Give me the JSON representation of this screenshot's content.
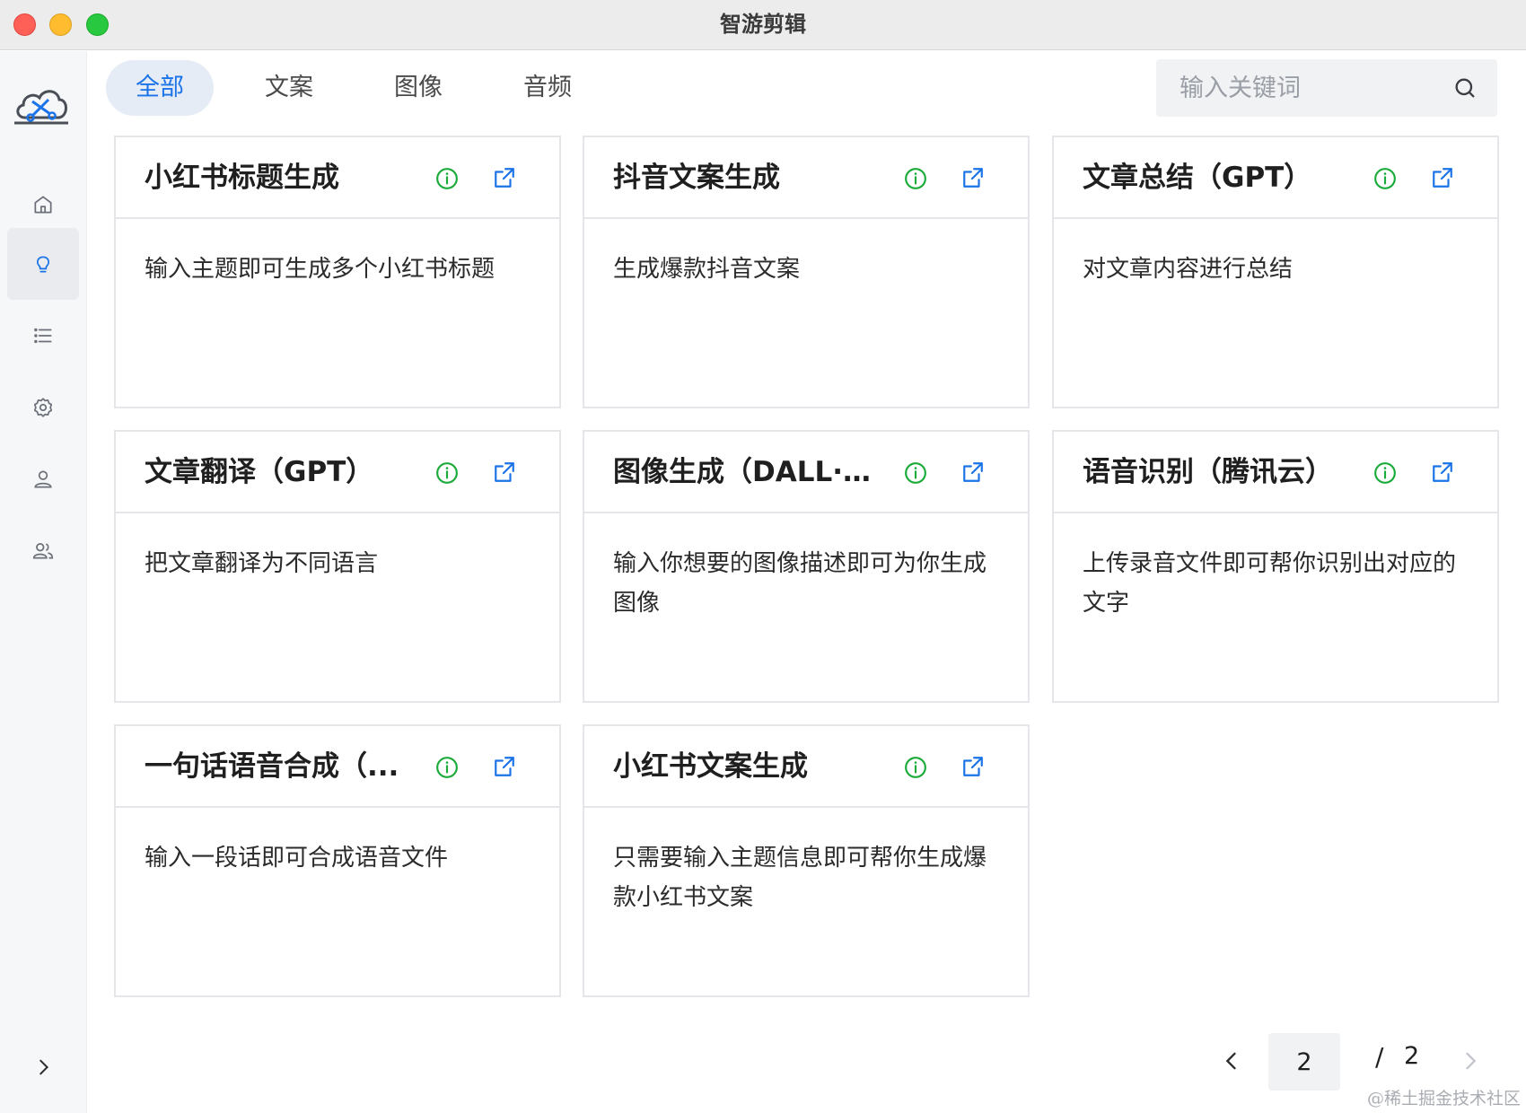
{
  "window": {
    "title": "智游剪辑"
  },
  "sidebar": {
    "logo": "cloud-scissors-logo",
    "items": [
      {
        "name": "home",
        "icon": "home-icon",
        "active": false
      },
      {
        "name": "ideas",
        "icon": "lightbulb-icon",
        "active": true
      },
      {
        "name": "list",
        "icon": "list-icon",
        "active": false
      },
      {
        "name": "settings",
        "icon": "gear-icon",
        "active": false
      },
      {
        "name": "user",
        "icon": "user-icon",
        "active": false
      },
      {
        "name": "team",
        "icon": "users-icon",
        "active": false
      }
    ],
    "collapse_icon": "chevron-right-icon"
  },
  "tabs": [
    {
      "label": "全部",
      "active": true
    },
    {
      "label": "文案",
      "active": false
    },
    {
      "label": "图像",
      "active": false
    },
    {
      "label": "音频",
      "active": false
    }
  ],
  "search": {
    "placeholder": "输入关键词",
    "value": ""
  },
  "cards": [
    {
      "title": "小红书标题生成",
      "description": "输入主题即可生成多个小红书标题"
    },
    {
      "title": "抖音文案生成",
      "description": "生成爆款抖音文案"
    },
    {
      "title": "文章总结（GPT）",
      "description": "对文章内容进行总结"
    },
    {
      "title": "文章翻译（GPT）",
      "description": "把文章翻译为不同语言"
    },
    {
      "title": "图像生成（DALL·E）",
      "description": "输入你想要的图像描述即可为你生成图像"
    },
    {
      "title": "语音识别（腾讯云）",
      "description": "上传录音文件即可帮你识别出对应的文字"
    },
    {
      "title": "一句话语音合成（...",
      "description": "输入一段话即可合成语音文件"
    },
    {
      "title": "小红书文案生成",
      "description": "只需要输入主题信息即可帮你生成爆款小红书文案"
    }
  ],
  "pagination": {
    "current": "2",
    "separator": "/",
    "total": "2"
  },
  "watermark": "@稀土掘金技术社区",
  "colors": {
    "accent": "#1a73e8",
    "info_icon": "#1aab3a",
    "open_icon": "#1a73e8",
    "active_tab_bg": "#e6ecf5"
  }
}
